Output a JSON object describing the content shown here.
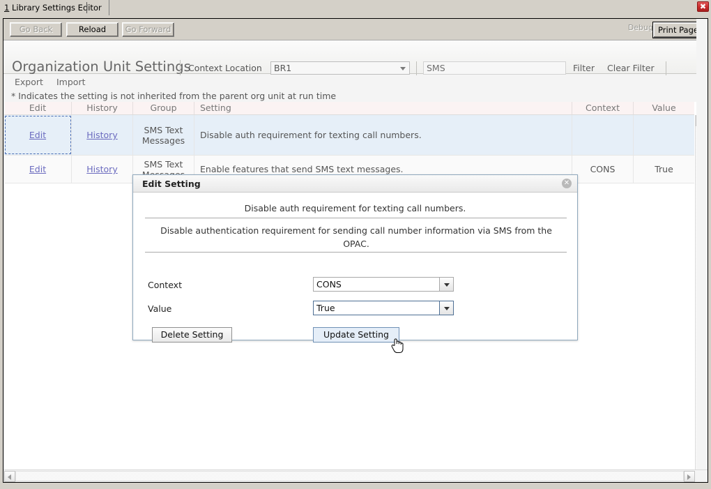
{
  "window": {
    "tab_accel": "1",
    "tab_label": " Library Settings Editor",
    "close_glyph": "✖"
  },
  "toolbar": {
    "go_back": "Go Back",
    "go_back_accel": "B",
    "reload": "Reload",
    "reload_accel": "l",
    "go_forward": "Go Forward",
    "go_forward_accel": "d",
    "debug": "Debug",
    "print_page": "Print Page",
    "print_page_accel": "P"
  },
  "header": {
    "title": "Organization Unit Settings",
    "context_location_label": "Context Location",
    "context_location_value": "BR1",
    "filter_value": "SMS",
    "filter_placeholder": "",
    "filter_button": "Filter",
    "clear_filter_button": "Clear Filter",
    "export_menu": "Export",
    "import_menu": "Import",
    "inherit_note": "* Indicates the setting is not inherited from the parent org unit at run time"
  },
  "grid": {
    "columns": [
      "Edit",
      "History",
      "Group",
      "Setting",
      "Context",
      "Value"
    ],
    "rows": [
      {
        "edit": "Edit",
        "history": "History",
        "group": "SMS Text Messages",
        "setting": "Disable auth requirement for texting call numbers.",
        "context": "",
        "value": ""
      },
      {
        "edit": "Edit",
        "history": "History",
        "group": "SMS Text Messages",
        "setting": "Enable features that send SMS text messages.",
        "context": "CONS",
        "value": "True"
      }
    ]
  },
  "dialog": {
    "title": "Edit Setting",
    "close_glyph": "✕",
    "setting_name": "Disable auth requirement for texting call numbers.",
    "description": "Disable authentication requirement for sending call number information via SMS from the OPAC.",
    "context_label": "Context",
    "context_value": "CONS",
    "value_label": "Value",
    "value_value": "True",
    "delete_button": "Delete Setting",
    "update_button": "Update Setting"
  },
  "colors": {
    "selected_row": "#e6eff8",
    "link": "#6b6bbf",
    "accent_border": "#6f90b5",
    "close_red": "#c92b2b"
  }
}
